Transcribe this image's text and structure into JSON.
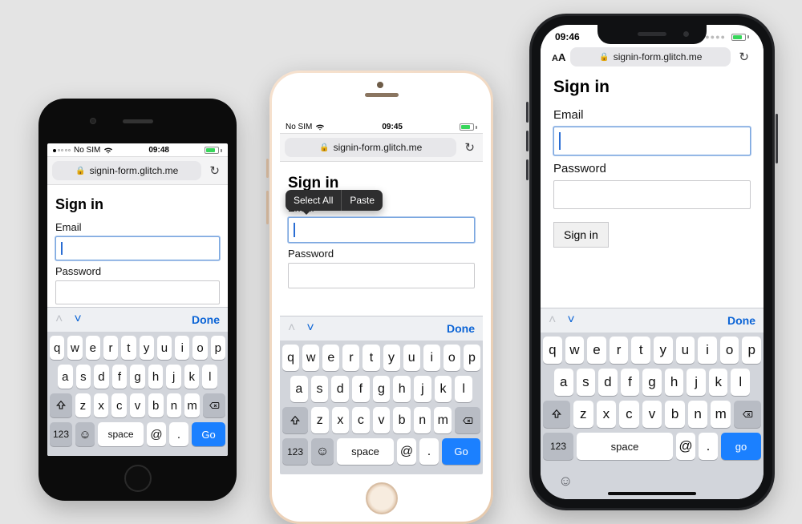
{
  "phones": {
    "p1": {
      "status": {
        "carrier": "No SIM",
        "time": "09:48"
      },
      "url": "signin-form.glitch.me",
      "title": "Sign in",
      "emailLabel": "Email",
      "passwordLabel": "Password"
    },
    "p2": {
      "status": {
        "carrier": "No SIM",
        "time": "09:45"
      },
      "url": "signin-form.glitch.me",
      "title": "Sign in",
      "emailLabel": "Email",
      "passwordLabel": "Password",
      "editmenu": {
        "selectAll": "Select All",
        "paste": "Paste"
      }
    },
    "p3": {
      "status": {
        "time": "09:46"
      },
      "url": "signin-form.glitch.me",
      "aa": "AA",
      "title": "Sign in",
      "emailLabel": "Email",
      "passwordLabel": "Password",
      "signinButton": "Sign in"
    }
  },
  "keyboard": {
    "done": "Done",
    "row1": [
      "q",
      "w",
      "e",
      "r",
      "t",
      "y",
      "u",
      "i",
      "o",
      "p"
    ],
    "row2": [
      "a",
      "s",
      "d",
      "f",
      "g",
      "h",
      "j",
      "k",
      "l"
    ],
    "row3": [
      "z",
      "x",
      "c",
      "v",
      "b",
      "n",
      "m"
    ],
    "numKey": "123",
    "space": "space",
    "at": "@",
    "dot": ".",
    "go": "Go",
    "goLower": "go"
  }
}
